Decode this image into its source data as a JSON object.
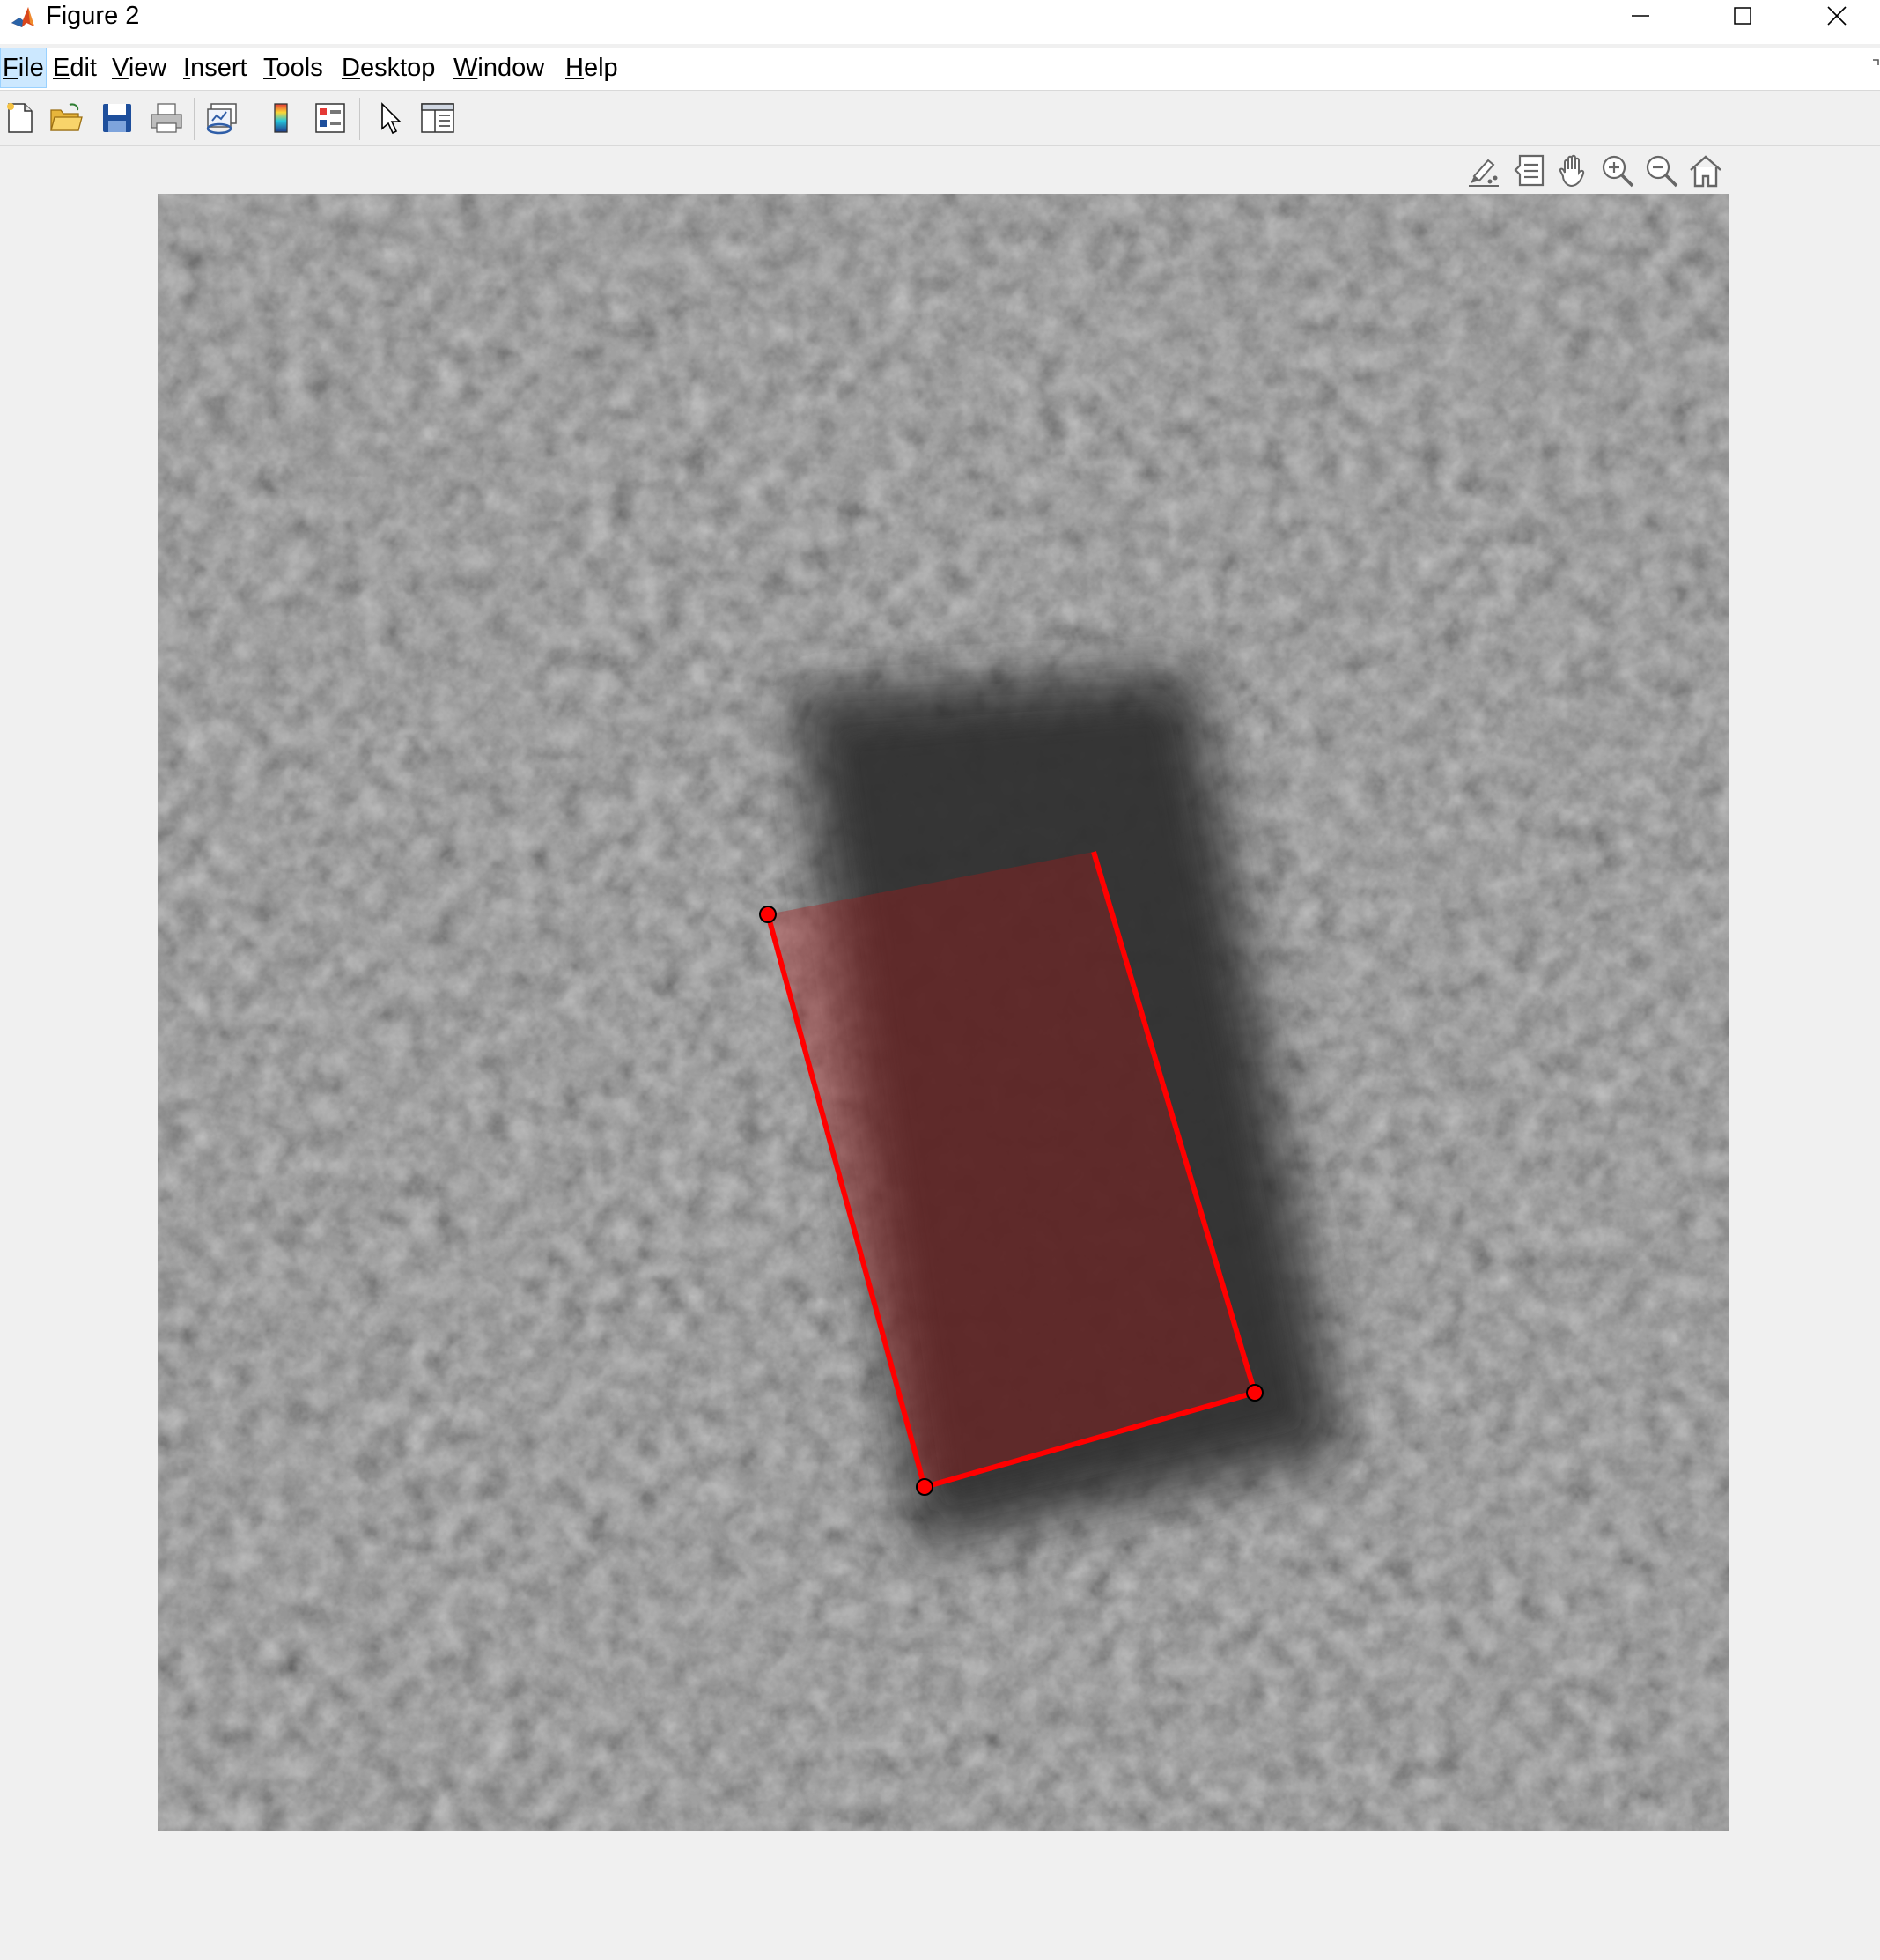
{
  "window": {
    "title": "Figure 2",
    "app_icon": "matlab-icon",
    "controls": [
      "minimize-icon",
      "maximize-icon",
      "close-icon"
    ]
  },
  "menubar": {
    "items": [
      {
        "label": "File",
        "mnemonic": "F",
        "rest": "ile",
        "active": true
      },
      {
        "label": "Edit",
        "mnemonic": "E",
        "rest": "dit",
        "active": false
      },
      {
        "label": "View",
        "mnemonic": "V",
        "rest": "iew",
        "active": false
      },
      {
        "label": "Insert",
        "mnemonic": "I",
        "rest": "nsert",
        "active": false
      },
      {
        "label": "Tools",
        "mnemonic": "T",
        "rest": "ools",
        "active": false
      },
      {
        "label": "Desktop",
        "mnemonic": "D",
        "rest": "esktop",
        "active": false
      },
      {
        "label": "Window",
        "mnemonic": "W",
        "rest": "indow",
        "active": false
      },
      {
        "label": "Help",
        "mnemonic": "H",
        "rest": "elp",
        "active": false
      }
    ]
  },
  "toolbar": {
    "buttons": [
      "new-figure-icon",
      "open-file-icon",
      "save-figure-icon",
      "print-figure-icon",
      "link-plot-icon",
      "insert-colorbar-icon",
      "insert-legend-icon",
      "edit-plot-icon",
      "open-property-inspector-icon"
    ]
  },
  "axes_toolbar": {
    "buttons": [
      "brush-data-icon",
      "data-tips-icon",
      "pan-icon",
      "zoom-in-icon",
      "zoom-out-icon",
      "restore-view-icon"
    ]
  },
  "figure": {
    "content": "grayscale image with a rectangular region of interest",
    "roi": {
      "shape": "rotated-rectangle",
      "edge_color": "#ff0000",
      "face_color": "#b01818",
      "face_alpha": 0.35,
      "vertex_handles": 3
    }
  }
}
